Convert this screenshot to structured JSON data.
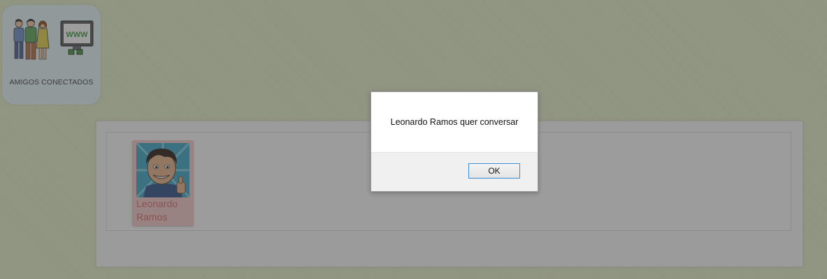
{
  "app_tile": {
    "label": "AMIGOS CONECTADOS",
    "screen_text": "WWW",
    "icons": [
      "people-icon",
      "monitor-icon"
    ]
  },
  "friends": [
    {
      "name": "Leonardo Ramos",
      "avatar": "avatar-boy-thumbs-up"
    }
  ],
  "dialog": {
    "message": "Leonardo Ramos quer conversar",
    "ok_label": "OK"
  },
  "colors": {
    "background": "#e7f1c9",
    "tile": "#e6f6fb",
    "friend_card": "#f6c8c8",
    "friend_name": "#d66b6b",
    "ok_border": "#3c8fd6"
  }
}
